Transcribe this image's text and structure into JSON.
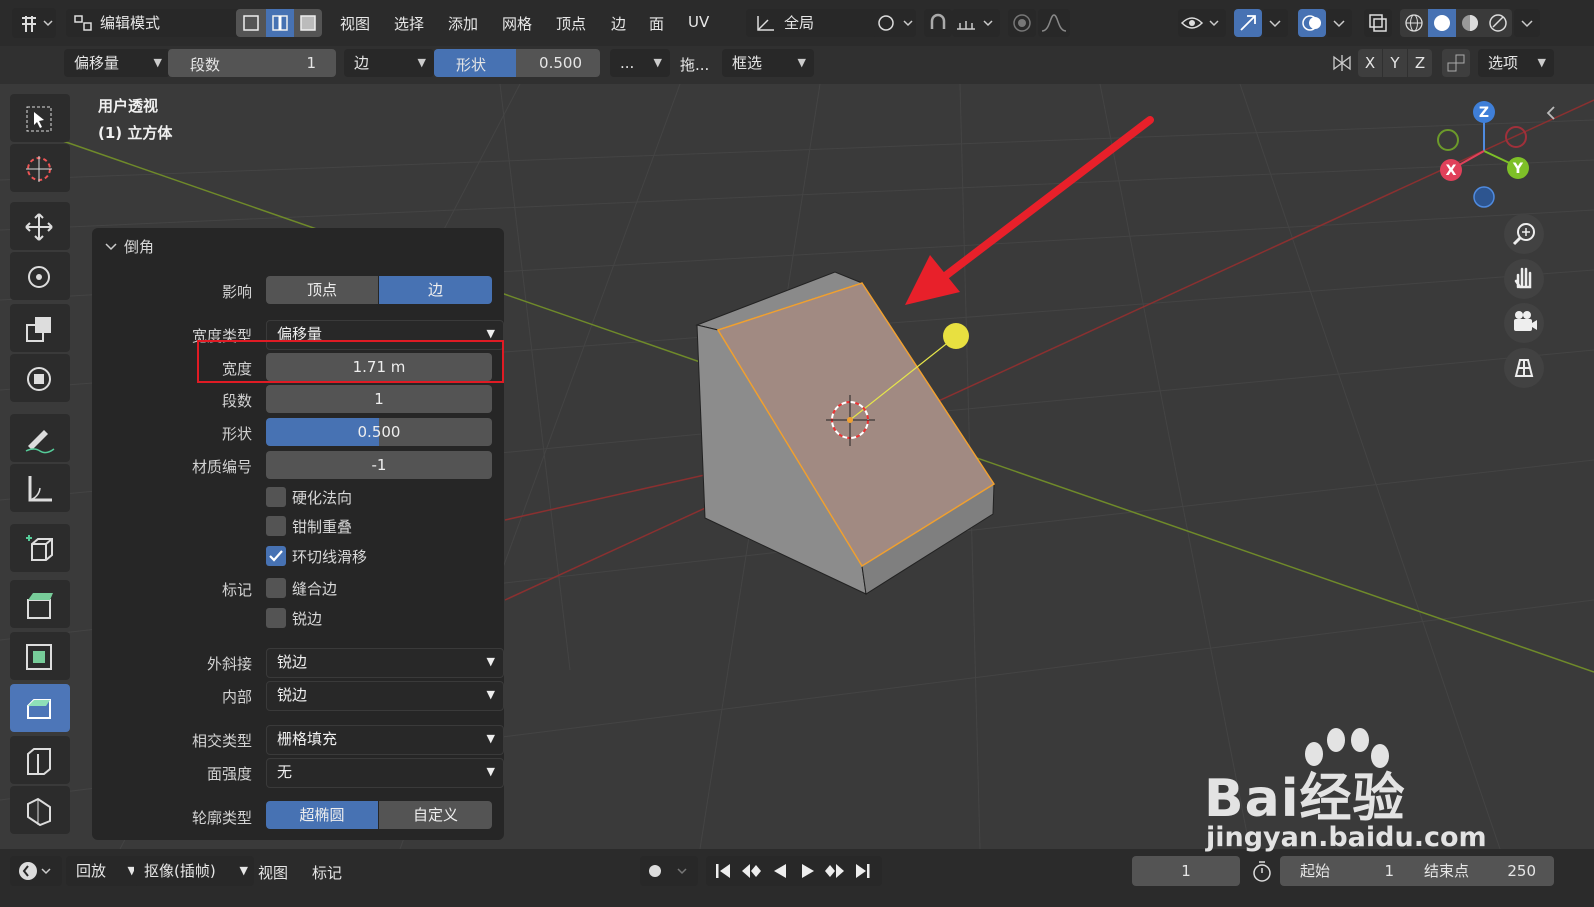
{
  "header": {
    "mode": "编辑模式",
    "menus": [
      "视图",
      "选择",
      "添加",
      "网格",
      "顶点",
      "边",
      "面",
      "UV"
    ],
    "transform_orientation": "全局"
  },
  "tool_header": {
    "width_type": "偏移量",
    "segments_label": "段数",
    "segments_value": "1",
    "affect": "边",
    "shape_label": "形状",
    "shape_value": "0.500",
    "more": "...",
    "drag_label": "拖...",
    "select_mode": "框选",
    "axes": [
      "X",
      "Y",
      "Z"
    ],
    "options": "选项"
  },
  "viewport": {
    "view_name": "用户透视",
    "object_name": "(1) 立方体"
  },
  "gizmo": {
    "z": "Z",
    "y": "Y",
    "x": "X"
  },
  "panel": {
    "title": "倒角",
    "affect_label": "影响",
    "affect_options": [
      "顶点",
      "边"
    ],
    "width_type_label": "宽度类型",
    "width_type_value": "偏移量",
    "width_label": "宽度",
    "width_value": "1.71 m",
    "segments_label": "段数",
    "segments_value": "1",
    "shape_label": "形状",
    "shape_value": "0.500",
    "material_label": "材质编号",
    "material_value": "-1",
    "harden_normals": "硬化法向",
    "clamp_overlap": "钳制重叠",
    "loop_slide": "环切线滑移",
    "mark_label": "标记",
    "mark_seam": "缝合边",
    "mark_sharp": "锐边",
    "miter_outer_label": "外斜接",
    "miter_outer_value": "锐边",
    "miter_inner_label": "内部",
    "miter_inner_value": "锐边",
    "intersection_label": "相交类型",
    "intersection_value": "栅格填充",
    "face_strength_label": "面强度",
    "face_strength_value": "无",
    "profile_label": "轮廓类型",
    "profile_options": [
      "超椭圆",
      "自定义"
    ]
  },
  "timeline": {
    "playback": "回放",
    "keying": "抠像(插帧)",
    "view": "视图",
    "marker": "标记",
    "current_frame": "1",
    "start_label": "起始",
    "start_value": "1",
    "end_label": "结束点",
    "end_value": "250"
  },
  "watermark": {
    "brand": "Bai经验",
    "url": "jingyan.baidu.com"
  },
  "colors": {
    "accent": "#4772b3",
    "header": "#2b2b2b",
    "panel": "#262626",
    "viewport": "#3a3a3a",
    "highlight_box": "#e01b24",
    "arrow": "#e8202a"
  }
}
